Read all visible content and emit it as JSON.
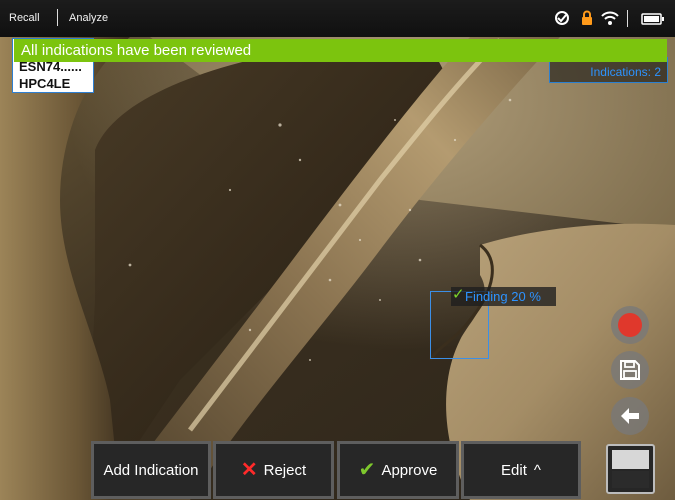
{
  "top_bar": {
    "modes": [
      "Recall",
      "Analyze"
    ],
    "status_icons": [
      "measure-gauge-icon",
      "lock-icon",
      "wifi-icon",
      "battery-icon"
    ]
  },
  "banner": {
    "message": "All indications have been reviewed",
    "color": "#7cc40e"
  },
  "id_tag": {
    "lines": [
      "ESN74......",
      "HPC4LE"
    ]
  },
  "indications": {
    "label": "Indications: 2"
  },
  "finding": {
    "label": "Finding 20 %",
    "color": "#2d93ff"
  },
  "side_controls": [
    "record-icon",
    "save-icon",
    "back-arrow-icon",
    "screen-layout-icon"
  ],
  "actions": {
    "add_indication": "Add Indication",
    "reject": "Reject",
    "approve": "Approve",
    "edit": "Edit"
  },
  "colors": {
    "accent_blue": "#2d93ff",
    "banner_green": "#7cc40e",
    "reject_red": "#ff2a2a",
    "approve_green": "#7ec82d",
    "record_red": "#e0382c"
  }
}
